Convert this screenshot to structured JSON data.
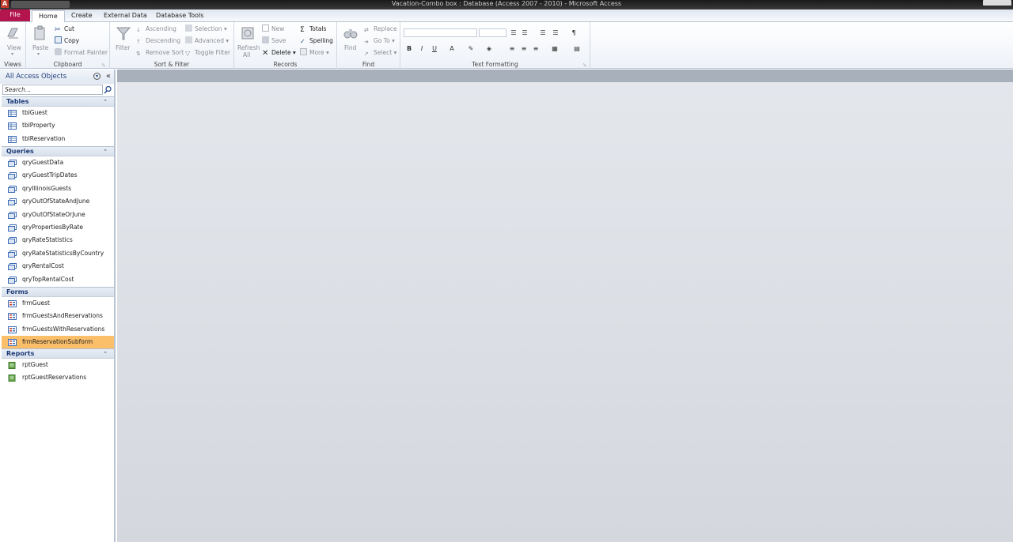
{
  "window": {
    "title": "Vacation-Combo box : Database (Access 2007 - 2010)  -  Microsoft Access",
    "app_icon_letter": "A"
  },
  "ribbon_tabs": [
    {
      "label": "File"
    },
    {
      "label": "Home"
    },
    {
      "label": "Create"
    },
    {
      "label": "External Data"
    },
    {
      "label": "Database Tools"
    }
  ],
  "ribbon": {
    "views": {
      "label": "Views",
      "view": "View"
    },
    "clipboard": {
      "label": "Clipboard",
      "paste": "Paste",
      "cut": "Cut",
      "copy": "Copy",
      "format_painter": "Format Painter"
    },
    "sort_filter": {
      "label": "Sort & Filter",
      "filter": "Filter",
      "ascending": "Ascending",
      "descending": "Descending",
      "remove_sort": "Remove Sort",
      "selection": "Selection",
      "advanced": "Advanced",
      "toggle_filter": "Toggle Filter"
    },
    "records": {
      "label": "Records",
      "refresh_all": "Refresh",
      "refresh_all_2": "All",
      "new": "New",
      "save": "Save",
      "delete": "Delete",
      "totals": "Totals",
      "spelling": "Spelling",
      "more": "More"
    },
    "find": {
      "label": "Find",
      "find": "Find",
      "replace": "Replace",
      "go_to": "Go To",
      "select": "Select"
    },
    "text_formatting": {
      "label": "Text Formatting",
      "bold": "B",
      "italic": "I",
      "underline": "U",
      "font_color": "A"
    }
  },
  "nav": {
    "header": "All Access Objects",
    "search_placeholder": "Search...",
    "groups": [
      {
        "name": "Tables",
        "items": [
          "tblGuest",
          "tblProperty",
          "tblReservation"
        ]
      },
      {
        "name": "Queries",
        "items": [
          "qryGuestData",
          "qryGuestTripDates",
          "qryIllinoisGuests",
          "qryOutOfStateAndJune",
          "qryOutOfStateOrJune",
          "qryPropertiesByRate",
          "qryRateStatistics",
          "qryRateStatisticsByCountry",
          "qryRentalCost",
          "qryTopRentalCost"
        ]
      },
      {
        "name": "Forms",
        "items": [
          "frmGuest",
          "frmGuestsAndReservations",
          "frmGuestsWithReservations",
          "frmReservationSubform"
        ]
      },
      {
        "name": "Reports",
        "items": [
          "rptGuest",
          "rptGuestReservations"
        ]
      }
    ],
    "selected_item": "frmReservationSubform"
  },
  "colors": {
    "file_tab": "#b3154c",
    "selected_item": "#fbbf6a",
    "nav_title": "#1f3c78"
  }
}
